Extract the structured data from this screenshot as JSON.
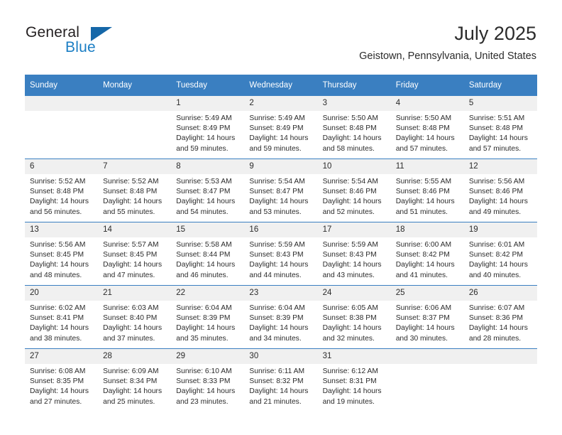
{
  "brand": {
    "name_part1": "General",
    "name_part2": "Blue"
  },
  "header": {
    "title": "July 2025",
    "location": "Geistown, Pennsylvania, United States"
  },
  "calendar": {
    "weekday_headers": [
      "Sunday",
      "Monday",
      "Tuesday",
      "Wednesday",
      "Thursday",
      "Friday",
      "Saturday"
    ],
    "colors": {
      "header_background": "#3a7fc1",
      "header_text": "#ffffff",
      "daynum_background": "#f0f0f0",
      "row_divider": "#3a7fc1",
      "brand_blue": "#1b7ec4"
    },
    "weeks": [
      [
        {
          "day": "",
          "lines": []
        },
        {
          "day": "",
          "lines": []
        },
        {
          "day": "1",
          "lines": [
            "Sunrise: 5:49 AM",
            "Sunset: 8:49 PM",
            "Daylight: 14 hours",
            "and 59 minutes."
          ]
        },
        {
          "day": "2",
          "lines": [
            "Sunrise: 5:49 AM",
            "Sunset: 8:49 PM",
            "Daylight: 14 hours",
            "and 59 minutes."
          ]
        },
        {
          "day": "3",
          "lines": [
            "Sunrise: 5:50 AM",
            "Sunset: 8:48 PM",
            "Daylight: 14 hours",
            "and 58 minutes."
          ]
        },
        {
          "day": "4",
          "lines": [
            "Sunrise: 5:50 AM",
            "Sunset: 8:48 PM",
            "Daylight: 14 hours",
            "and 57 minutes."
          ]
        },
        {
          "day": "5",
          "lines": [
            "Sunrise: 5:51 AM",
            "Sunset: 8:48 PM",
            "Daylight: 14 hours",
            "and 57 minutes."
          ]
        }
      ],
      [
        {
          "day": "6",
          "lines": [
            "Sunrise: 5:52 AM",
            "Sunset: 8:48 PM",
            "Daylight: 14 hours",
            "and 56 minutes."
          ]
        },
        {
          "day": "7",
          "lines": [
            "Sunrise: 5:52 AM",
            "Sunset: 8:48 PM",
            "Daylight: 14 hours",
            "and 55 minutes."
          ]
        },
        {
          "day": "8",
          "lines": [
            "Sunrise: 5:53 AM",
            "Sunset: 8:47 PM",
            "Daylight: 14 hours",
            "and 54 minutes."
          ]
        },
        {
          "day": "9",
          "lines": [
            "Sunrise: 5:54 AM",
            "Sunset: 8:47 PM",
            "Daylight: 14 hours",
            "and 53 minutes."
          ]
        },
        {
          "day": "10",
          "lines": [
            "Sunrise: 5:54 AM",
            "Sunset: 8:46 PM",
            "Daylight: 14 hours",
            "and 52 minutes."
          ]
        },
        {
          "day": "11",
          "lines": [
            "Sunrise: 5:55 AM",
            "Sunset: 8:46 PM",
            "Daylight: 14 hours",
            "and 51 minutes."
          ]
        },
        {
          "day": "12",
          "lines": [
            "Sunrise: 5:56 AM",
            "Sunset: 8:46 PM",
            "Daylight: 14 hours",
            "and 49 minutes."
          ]
        }
      ],
      [
        {
          "day": "13",
          "lines": [
            "Sunrise: 5:56 AM",
            "Sunset: 8:45 PM",
            "Daylight: 14 hours",
            "and 48 minutes."
          ]
        },
        {
          "day": "14",
          "lines": [
            "Sunrise: 5:57 AM",
            "Sunset: 8:45 PM",
            "Daylight: 14 hours",
            "and 47 minutes."
          ]
        },
        {
          "day": "15",
          "lines": [
            "Sunrise: 5:58 AM",
            "Sunset: 8:44 PM",
            "Daylight: 14 hours",
            "and 46 minutes."
          ]
        },
        {
          "day": "16",
          "lines": [
            "Sunrise: 5:59 AM",
            "Sunset: 8:43 PM",
            "Daylight: 14 hours",
            "and 44 minutes."
          ]
        },
        {
          "day": "17",
          "lines": [
            "Sunrise: 5:59 AM",
            "Sunset: 8:43 PM",
            "Daylight: 14 hours",
            "and 43 minutes."
          ]
        },
        {
          "day": "18",
          "lines": [
            "Sunrise: 6:00 AM",
            "Sunset: 8:42 PM",
            "Daylight: 14 hours",
            "and 41 minutes."
          ]
        },
        {
          "day": "19",
          "lines": [
            "Sunrise: 6:01 AM",
            "Sunset: 8:42 PM",
            "Daylight: 14 hours",
            "and 40 minutes."
          ]
        }
      ],
      [
        {
          "day": "20",
          "lines": [
            "Sunrise: 6:02 AM",
            "Sunset: 8:41 PM",
            "Daylight: 14 hours",
            "and 38 minutes."
          ]
        },
        {
          "day": "21",
          "lines": [
            "Sunrise: 6:03 AM",
            "Sunset: 8:40 PM",
            "Daylight: 14 hours",
            "and 37 minutes."
          ]
        },
        {
          "day": "22",
          "lines": [
            "Sunrise: 6:04 AM",
            "Sunset: 8:39 PM",
            "Daylight: 14 hours",
            "and 35 minutes."
          ]
        },
        {
          "day": "23",
          "lines": [
            "Sunrise: 6:04 AM",
            "Sunset: 8:39 PM",
            "Daylight: 14 hours",
            "and 34 minutes."
          ]
        },
        {
          "day": "24",
          "lines": [
            "Sunrise: 6:05 AM",
            "Sunset: 8:38 PM",
            "Daylight: 14 hours",
            "and 32 minutes."
          ]
        },
        {
          "day": "25",
          "lines": [
            "Sunrise: 6:06 AM",
            "Sunset: 8:37 PM",
            "Daylight: 14 hours",
            "and 30 minutes."
          ]
        },
        {
          "day": "26",
          "lines": [
            "Sunrise: 6:07 AM",
            "Sunset: 8:36 PM",
            "Daylight: 14 hours",
            "and 28 minutes."
          ]
        }
      ],
      [
        {
          "day": "27",
          "lines": [
            "Sunrise: 6:08 AM",
            "Sunset: 8:35 PM",
            "Daylight: 14 hours",
            "and 27 minutes."
          ]
        },
        {
          "day": "28",
          "lines": [
            "Sunrise: 6:09 AM",
            "Sunset: 8:34 PM",
            "Daylight: 14 hours",
            "and 25 minutes."
          ]
        },
        {
          "day": "29",
          "lines": [
            "Sunrise: 6:10 AM",
            "Sunset: 8:33 PM",
            "Daylight: 14 hours",
            "and 23 minutes."
          ]
        },
        {
          "day": "30",
          "lines": [
            "Sunrise: 6:11 AM",
            "Sunset: 8:32 PM",
            "Daylight: 14 hours",
            "and 21 minutes."
          ]
        },
        {
          "day": "31",
          "lines": [
            "Sunrise: 6:12 AM",
            "Sunset: 8:31 PM",
            "Daylight: 14 hours",
            "and 19 minutes."
          ]
        },
        {
          "day": "",
          "lines": []
        },
        {
          "day": "",
          "lines": []
        }
      ]
    ]
  }
}
